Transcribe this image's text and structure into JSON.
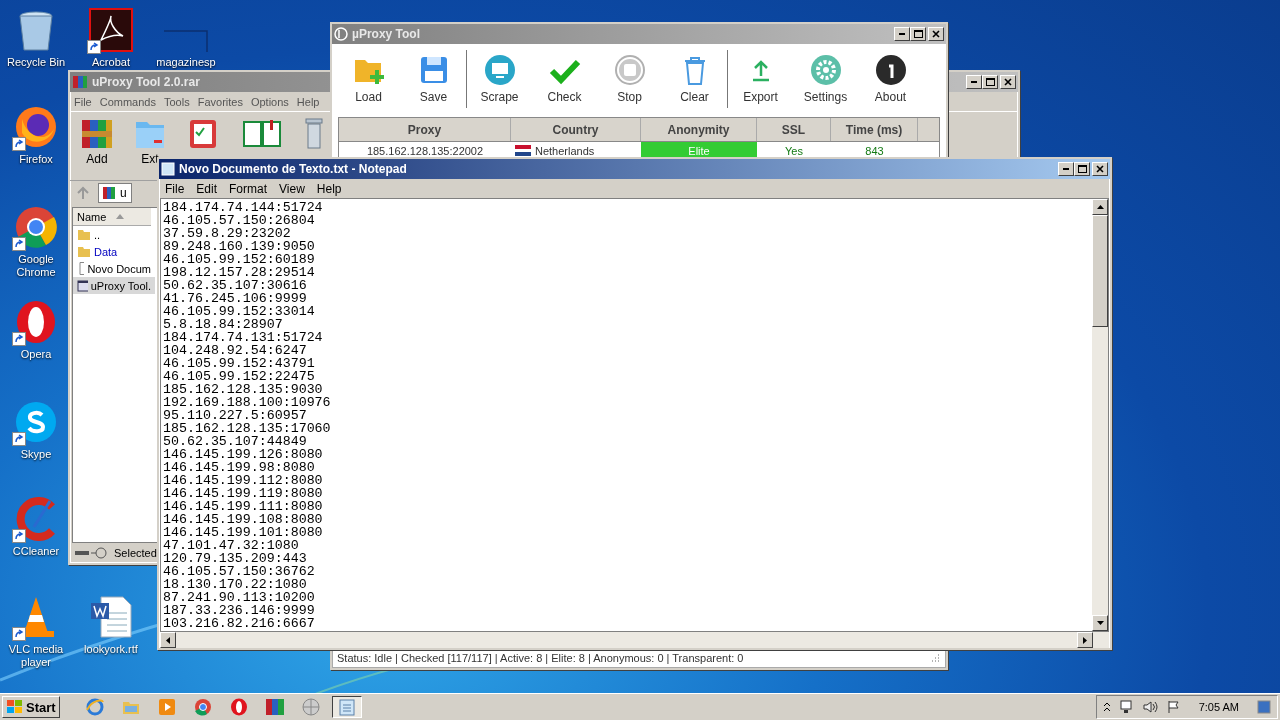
{
  "desktop_icons": [
    {
      "label": "Recycle Bin",
      "kind": "recycle",
      "shortcut": false
    },
    {
      "label": "Acrobat",
      "kind": "acrobat",
      "shortcut": true
    },
    {
      "label": "magazinesp",
      "kind": "blank",
      "shortcut": false
    },
    {
      "label": "Firefox",
      "kind": "firefox",
      "shortcut": true
    },
    {
      "label": "Google Chrome",
      "kind": "chrome",
      "shortcut": true
    },
    {
      "label": "Opera",
      "kind": "opera",
      "shortcut": true
    },
    {
      "label": "Skype",
      "kind": "skype",
      "shortcut": true
    },
    {
      "label": "CCleaner",
      "kind": "ccleaner",
      "shortcut": true
    },
    {
      "label": "VLC media player",
      "kind": "vlc",
      "shortcut": true
    },
    {
      "label": "lookyork.rtf",
      "kind": "word",
      "shortcut": false
    }
  ],
  "winrar": {
    "title": "uProxy Tool 2.0.rar",
    "menu": [
      "File",
      "Commands",
      "Tools",
      "Favorites",
      "Options",
      "Help"
    ],
    "toolbar": [
      {
        "label": "Add",
        "kind": "add"
      },
      {
        "label": "Ext",
        "kind": "extract"
      },
      {
        "kind": "test"
      },
      {
        "kind": "view"
      },
      {
        "kind": "delete"
      }
    ],
    "address": "u",
    "columns": [
      "Name"
    ],
    "files": [
      {
        "name": "..",
        "kind": "up",
        "selected": false
      },
      {
        "name": "Data",
        "kind": "folder",
        "selected": false
      },
      {
        "name": "Novo Docum",
        "kind": "text",
        "selected": false
      },
      {
        "name": "uProxy Tool.",
        "kind": "app",
        "selected": true
      }
    ],
    "status": "Selected"
  },
  "uproxy": {
    "title": "µProxy Tool",
    "toolbar": [
      {
        "label": "Load",
        "kind": "load"
      },
      {
        "label": "Save",
        "kind": "save"
      },
      {
        "label": "Scrape",
        "kind": "scrape"
      },
      {
        "label": "Check",
        "kind": "check"
      },
      {
        "label": "Stop",
        "kind": "stop"
      },
      {
        "label": "Clear",
        "kind": "clear"
      },
      {
        "label": "Export",
        "kind": "export"
      },
      {
        "label": "Settings",
        "kind": "settings"
      },
      {
        "label": "About",
        "kind": "about"
      }
    ],
    "columns": [
      "Proxy",
      "Country",
      "Anonymity",
      "SSL",
      "Time (ms)"
    ],
    "rows": [
      {
        "proxy": "185.162.128.135:22002",
        "country": "Netherlands",
        "anonymity": "Elite",
        "ssl": "Yes",
        "time": "843"
      }
    ],
    "status": "Status: Idle | Checked [117/117] | Active: 8 | Elite: 8 | Anonymous: 0 | Transparent: 0"
  },
  "notepad": {
    "title": "Novo Documento de Texto.txt - Notepad",
    "menu": [
      "File",
      "Edit",
      "Format",
      "View",
      "Help"
    ],
    "lines": [
      "184.174.74.144:51724",
      "46.105.57.150:26804",
      "37.59.8.29:23202",
      "89.248.160.139:9050",
      "46.105.99.152:60189",
      "198.12.157.28:29514",
      "50.62.35.107:30616",
      "41.76.245.106:9999",
      "46.105.99.152:33014",
      "5.8.18.84:28907",
      "184.174.74.131:51724",
      "104.248.92.54:6247",
      "46.105.99.152:43791",
      "46.105.99.152:22475",
      "185.162.128.135:9030",
      "192.169.188.100:10976",
      "95.110.227.5:60957",
      "185.162.128.135:17060",
      "50.62.35.107:44849",
      "146.145.199.126:8080",
      "146.145.199.98:8080",
      "146.145.199.112:8080",
      "146.145.199.119:8080",
      "146.145.199.111:8080",
      "146.145.199.108:8080",
      "146.145.199.101:8080",
      "47.101.47.32:1080",
      "120.79.135.209:443",
      "46.105.57.150:36762",
      "18.130.170.22:1080",
      "87.241.90.113:10200",
      "187.33.236.146:9999",
      "103.216.82.216:6667"
    ]
  },
  "taskbar": {
    "start": "Start",
    "apps": [
      {
        "kind": "ie",
        "selected": false
      },
      {
        "kind": "explorer",
        "selected": false
      },
      {
        "kind": "media",
        "selected": false
      },
      {
        "kind": "chrome",
        "selected": false
      },
      {
        "kind": "opera",
        "selected": false
      },
      {
        "kind": "winrar",
        "selected": false
      },
      {
        "kind": "uproxy",
        "selected": false
      },
      {
        "kind": "notepad",
        "selected": true
      }
    ],
    "tray": [
      {
        "kind": "chevron"
      },
      {
        "kind": "network"
      },
      {
        "kind": "speaker"
      },
      {
        "kind": "flag"
      }
    ],
    "clock": "7:05 AM"
  }
}
